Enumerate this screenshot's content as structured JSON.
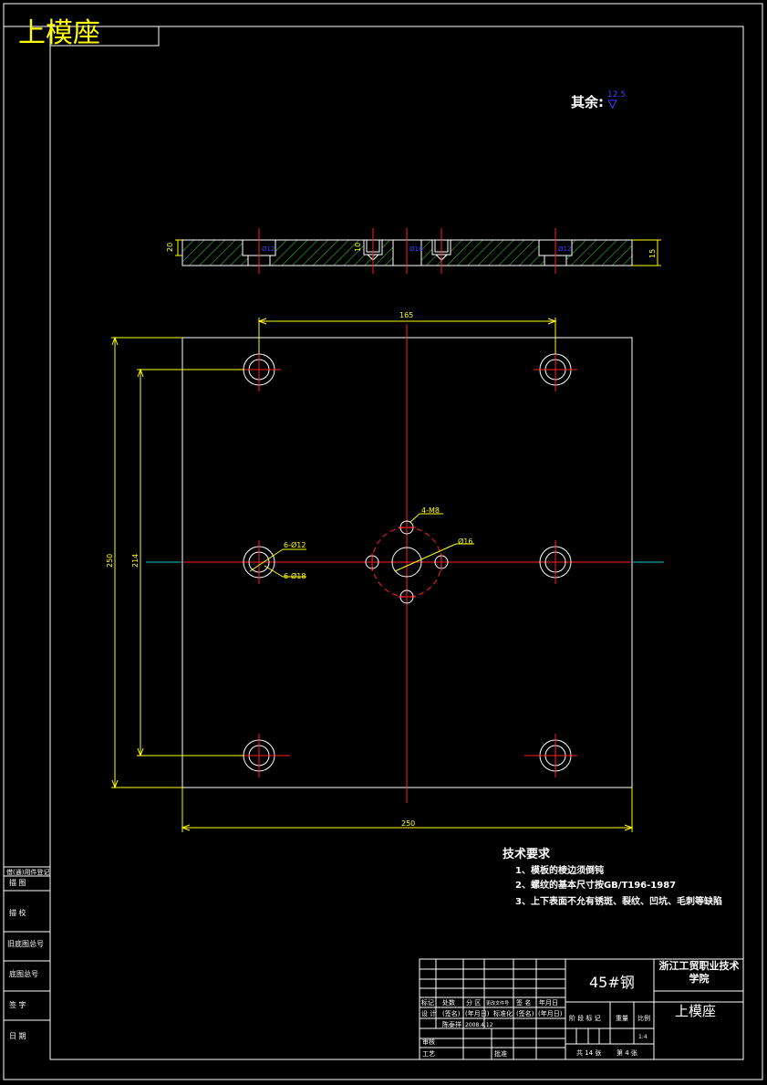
{
  "title_block_top": "上模座",
  "roughness": {
    "label": "其余:",
    "value": "12.5"
  },
  "dimensions": {
    "width_top": "165",
    "width_bottom": "250",
    "height_outer": "250",
    "height_inner": "214",
    "hole_top": "4-M8",
    "hole_center": "Ø16",
    "hole_cbore_small": "6-Ø12",
    "hole_cbore_large": "6-Ø18",
    "section_h1": "20",
    "section_h2": "10",
    "section_h3": "15",
    "section_c1": "Ø12",
    "section_c2": "Ø8",
    "section_c3": "Ø16"
  },
  "tech": {
    "heading": "技术要求",
    "items": [
      "1、模板的棱边须倒钝",
      "2、螺纹的基本尺寸按GB/T196-1987",
      "3、上下表面不允有锈斑、裂纹、凹坑、毛刺等缺陷"
    ]
  },
  "side_labels": [
    "借(通)用件登记",
    "描   图",
    "描   校",
    "旧底图总号",
    "底图总号",
    "签   字",
    "日   期"
  ],
  "title_block": {
    "material": "45#钢",
    "school": "浙江工贸职业技术学院",
    "part_name": "上模座",
    "row_labels": [
      "标记",
      "处数",
      "分 区",
      "更改文件号",
      "签 名",
      "年月日"
    ],
    "design": [
      "设 计",
      "(签名)",
      "(年月日)",
      "标准化",
      "(签名)",
      "(年月日)"
    ],
    "designer": "陈泰祥",
    "date": "2008.4.12",
    "review": "审核",
    "process": "工艺",
    "approve": "批准",
    "stage": "阶 段 标 记",
    "weight": "重量",
    "scale": "比例",
    "scale_value": "1:4",
    "sheets": "共 14 张",
    "sheet_no": "第 4 张"
  }
}
